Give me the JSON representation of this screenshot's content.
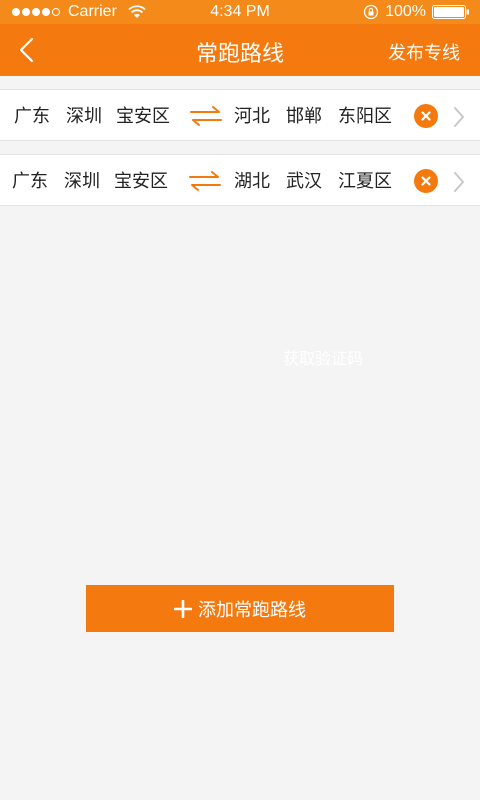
{
  "status_bar": {
    "carrier": "Carrier",
    "time": "4:34 PM",
    "battery": "100%"
  },
  "header": {
    "title": "常跑路线",
    "action_label": "发布专线",
    "background": "#f47a10"
  },
  "routes": [
    {
      "from": {
        "province": "广东",
        "city": "深圳",
        "district": "宝安区"
      },
      "to": {
        "province": "河北",
        "city": "邯郸",
        "district": "东阳区"
      }
    },
    {
      "from": {
        "province": "广东",
        "city": "深圳",
        "district": "宝安区"
      },
      "to": {
        "province": "湖北",
        "city": "武汉",
        "district": "江夏区"
      }
    }
  ],
  "hint": "获取验证码",
  "add_button": {
    "label": "添加常跑路线"
  },
  "colors": {
    "accent": "#f47a10",
    "status_bar": "#f48a1a",
    "background": "#f5f4f4"
  }
}
